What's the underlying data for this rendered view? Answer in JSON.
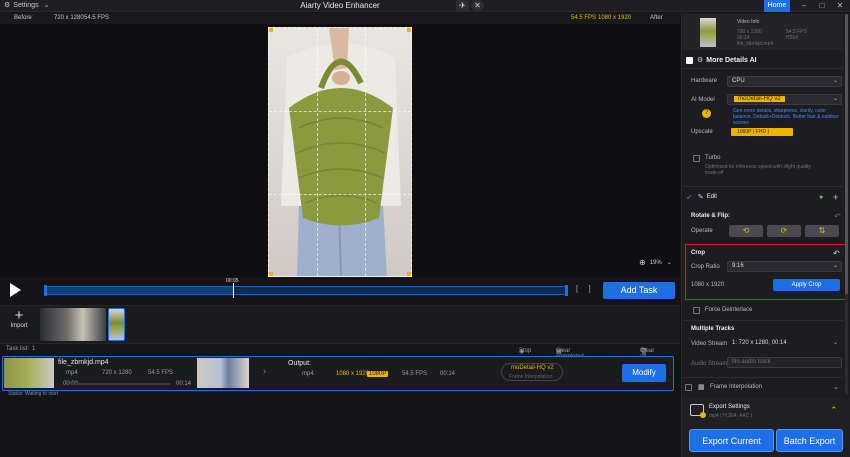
{
  "titlebar": {
    "settings": "Settings",
    "title": "Aiarty Video Enhancer",
    "home": "Home"
  },
  "preview": {
    "before": "Before",
    "before_res": "720 x 1280",
    "before_fps": "54.5 FPS",
    "after_fps": "54.5 FPS",
    "after_res": "1080 x 1920",
    "after": "After",
    "zoom": "19%"
  },
  "timeline": {
    "timecode": "00:05",
    "add_task": "Add Task",
    "progress": 0.36
  },
  "media": {
    "import": "Import"
  },
  "tasklist": {
    "label": "Task list:",
    "count": "1",
    "stop": "Stop",
    "clear_completed": "Clear completed tasks",
    "clear_all": "Clear all",
    "task": {
      "filename": "file_zbmkjd.mp4",
      "format": "mp4",
      "res": "720 x 1280",
      "fps": "54.5 FPS",
      "start": "00:00",
      "duration": "00:14",
      "output_label": "Output:",
      "out_format": "mp4",
      "out_res": "1080 x 1920",
      "out_badge": "1080P",
      "out_fps": "54.5 FPS",
      "out_duration": "00:14",
      "model": "moDetail-HQ  v2",
      "frame_interp": "Frame Interpolation",
      "modify": "Modify",
      "status": "Status: Waiting to start"
    }
  },
  "panel": {
    "video_info": {
      "title": "Video Info",
      "line1": "720 x 1280",
      "line1b": "54.5 FPS",
      "line2": "00:14",
      "line2b": "H264",
      "line3": "file_zbmkjd.mp4"
    },
    "more_details": {
      "title": "More Details AI",
      "hardware_label": "Hardware",
      "hardware": "CPU",
      "ai_model_label": "AI Model",
      "ai_model": "moDetail-HQ  v2",
      "ai_desc": "Gen more details, sharpness, clarity, color balance. Debulk+Deblock. Better hair & outdoor scenes",
      "upscale_label": "Upscale",
      "upscale": "1080P  ( FHD )",
      "turbo": "Turbo",
      "turbo_desc": "Optimized for inference speed with slight quality trade-off"
    },
    "edit": {
      "title": "Edit",
      "rotate_title": "Rotate & Flip:",
      "operate_label": "Operate"
    },
    "crop": {
      "title": "Crop",
      "ratio_label": "Crop Ratio",
      "ratio": "9:16",
      "size": "1080 x 1920",
      "apply": "Apply Crop"
    },
    "force_deinterlace": "Force Deinterlace",
    "multiple_tracks": {
      "title": "Multiple Tracks",
      "video_stream_label": "Video Stream",
      "video_stream": "1: 720 x 1280,  00:14",
      "audio_stream_label": "Audio Stream",
      "audio_stream": "No audio track"
    },
    "frame_interpolation": "Frame Interpolation",
    "export": {
      "title": "Export Settings",
      "sub": "mp4 ( H.264, AAC )",
      "export_current": "Export Current",
      "batch_export": "Batch Export"
    }
  }
}
